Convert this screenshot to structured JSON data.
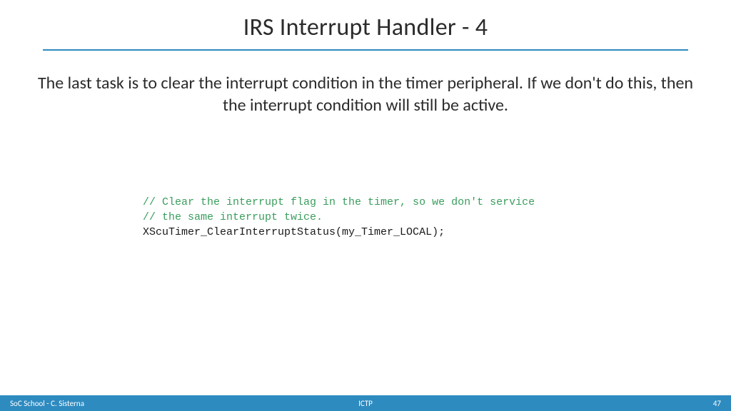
{
  "title": "IRS Interrupt Handler - 4",
  "body": "The last task is to clear the interrupt condition in the timer peripheral. If we don't do this, then the interrupt condition will still be active.",
  "code": {
    "c1": "// Clear the interrupt flag in the timer, so we don't service",
    "c2": "// the same interrupt twice.",
    "s1": "XScuTimer_ClearInterruptStatus(my_Timer_LOCAL);"
  },
  "footer": {
    "left": "SoC School - C. Sisterna",
    "center": "ICTP",
    "right": "47"
  }
}
